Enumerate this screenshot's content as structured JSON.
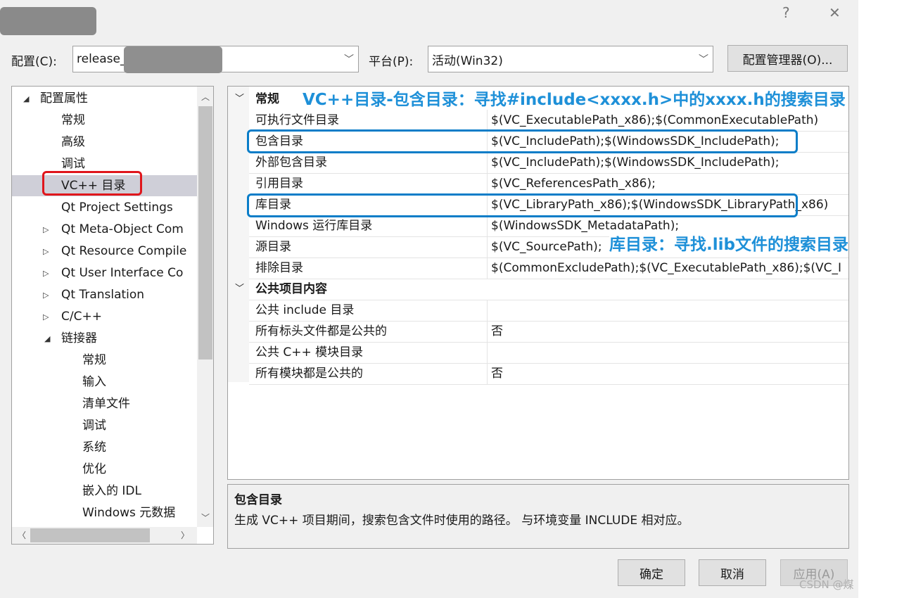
{
  "window": {
    "help_glyph": "?",
    "close_glyph": "✕"
  },
  "config": {
    "label": "配置(C):",
    "value": "release_",
    "platform_label": "平台(P):",
    "platform_value": "活动(Win32)",
    "manager_button": "配置管理器(O)..."
  },
  "tree": {
    "items": [
      {
        "label": "配置属性",
        "expander": "◢"
      },
      {
        "label": "常规"
      },
      {
        "label": "高级"
      },
      {
        "label": "调试"
      },
      {
        "label": "VC++ 目录"
      },
      {
        "label": "Qt Project Settings"
      },
      {
        "label": "Qt Meta-Object Com",
        "expander": "▷"
      },
      {
        "label": "Qt Resource Compile",
        "expander": "▷"
      },
      {
        "label": "Qt User Interface Co",
        "expander": "▷"
      },
      {
        "label": "Qt Translation",
        "expander": "▷"
      },
      {
        "label": "C/C++",
        "expander": "▷"
      },
      {
        "label": "链接器",
        "expander": "◢"
      },
      {
        "label": "常规"
      },
      {
        "label": "输入"
      },
      {
        "label": "清单文件"
      },
      {
        "label": "调试"
      },
      {
        "label": "系统"
      },
      {
        "label": "优化"
      },
      {
        "label": "嵌入的 IDL"
      },
      {
        "label": "Windows 元数据"
      }
    ]
  },
  "grid": {
    "category1": "常规",
    "rows1": [
      {
        "name": "可执行文件目录",
        "value": "$(VC_ExecutablePath_x86);$(CommonExecutablePath)"
      },
      {
        "name": "包含目录",
        "value": "$(VC_IncludePath);$(WindowsSDK_IncludePath);"
      },
      {
        "name": "外部包含目录",
        "value": "$(VC_IncludePath);$(WindowsSDK_IncludePath);"
      },
      {
        "name": "引用目录",
        "value": "$(VC_ReferencesPath_x86);"
      },
      {
        "name": "库目录",
        "value": "$(VC_LibraryPath_x86);$(WindowsSDK_LibraryPath_x86)"
      },
      {
        "name": "Windows 运行库目录",
        "value": "$(WindowsSDK_MetadataPath);"
      },
      {
        "name": "源目录",
        "value": "$(VC_SourcePath);"
      },
      {
        "name": "排除目录",
        "value": "$(CommonExcludePath);$(VC_ExecutablePath_x86);$(VC_I"
      }
    ],
    "category2": "公共项目内容",
    "rows2": [
      {
        "name": "公共 include 目录",
        "value": ""
      },
      {
        "name": "所有标头文件都是公共的",
        "value": "否"
      },
      {
        "name": "公共 C++ 模块目录",
        "value": ""
      },
      {
        "name": "所有模块都是公共的",
        "value": "否"
      }
    ]
  },
  "description": {
    "title": "包含目录",
    "text": "生成 VC++ 项目期间，搜索包含文件时使用的路径。 与环境变量 INCLUDE 相对应。"
  },
  "buttons": {
    "ok": "确定",
    "cancel": "取消",
    "apply": "应用(A)"
  },
  "annotations": {
    "include_note": "VC++目录-包含目录：寻找#include<xxxx.h>中的xxxx.h的搜索目录",
    "lib_note": "库目录：寻找.lib文件的搜索目录",
    "color": "#1e90d8"
  },
  "watermark": "CSDN @煤"
}
